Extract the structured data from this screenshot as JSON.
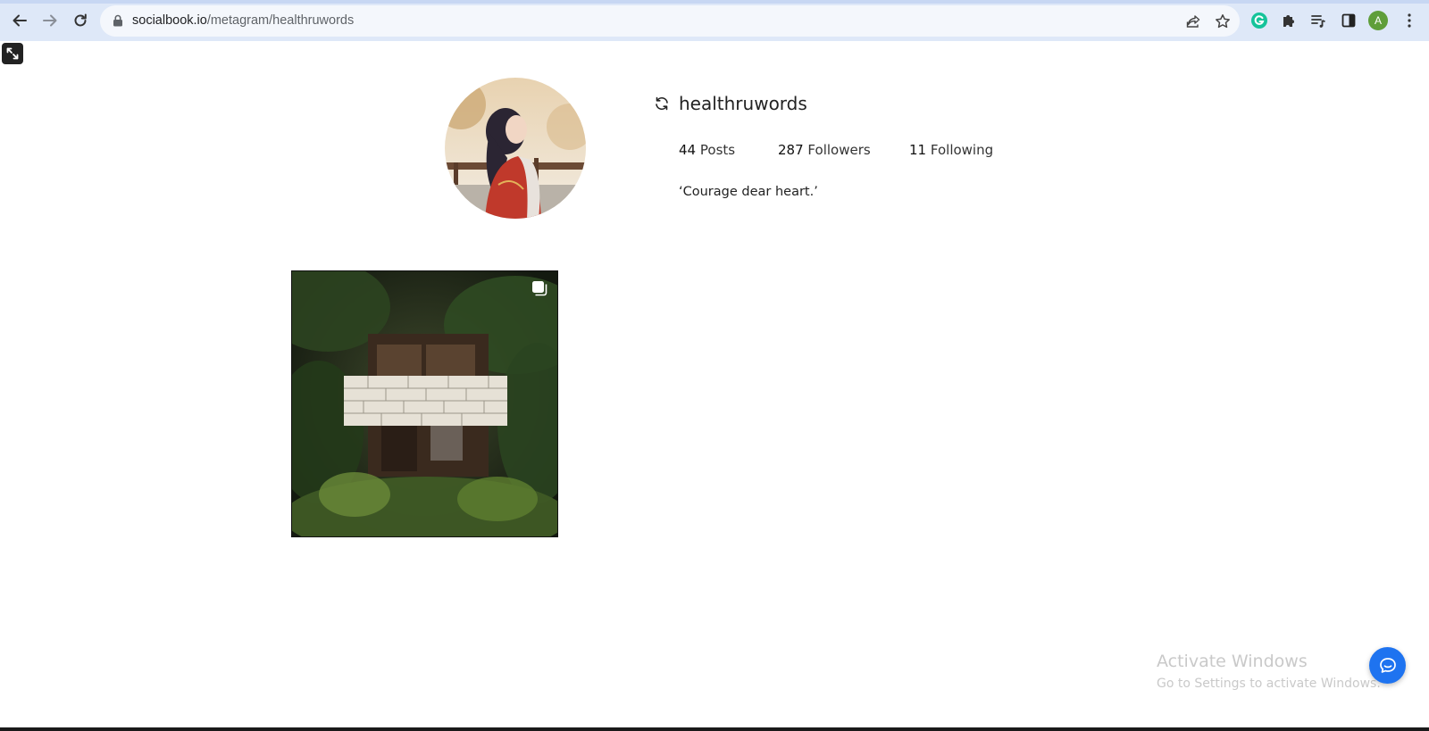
{
  "browser": {
    "url_domain": "socialbook.io",
    "url_path": "/metagram/healthruwords",
    "profile_initial": "A"
  },
  "profile": {
    "username": "healthruwords",
    "stats": [
      {
        "count": "44",
        "label": "Posts"
      },
      {
        "count": "287",
        "label": "Followers"
      },
      {
        "count": "11",
        "label": "Following"
      }
    ],
    "bio": "‘Courage dear heart.’"
  },
  "watermark": {
    "title": "Activate Windows",
    "subtitle": "Go to Settings to activate Windows."
  },
  "colors": {
    "chrome": "#dee8f8",
    "omnibox": "#f4f7fc",
    "accent": "#1e73f0",
    "grammarly": "#15c39a"
  },
  "icons": [
    "back-arrow-icon",
    "forward-arrow-icon",
    "reload-icon",
    "lock-icon",
    "share-icon",
    "star-icon",
    "grammarly-icon",
    "puzzle-icon",
    "reading-list-icon",
    "side-panel-icon",
    "kebab-menu-icon",
    "expand-icon",
    "sync-icon",
    "multiple-posts-icon",
    "chat-icon"
  ]
}
